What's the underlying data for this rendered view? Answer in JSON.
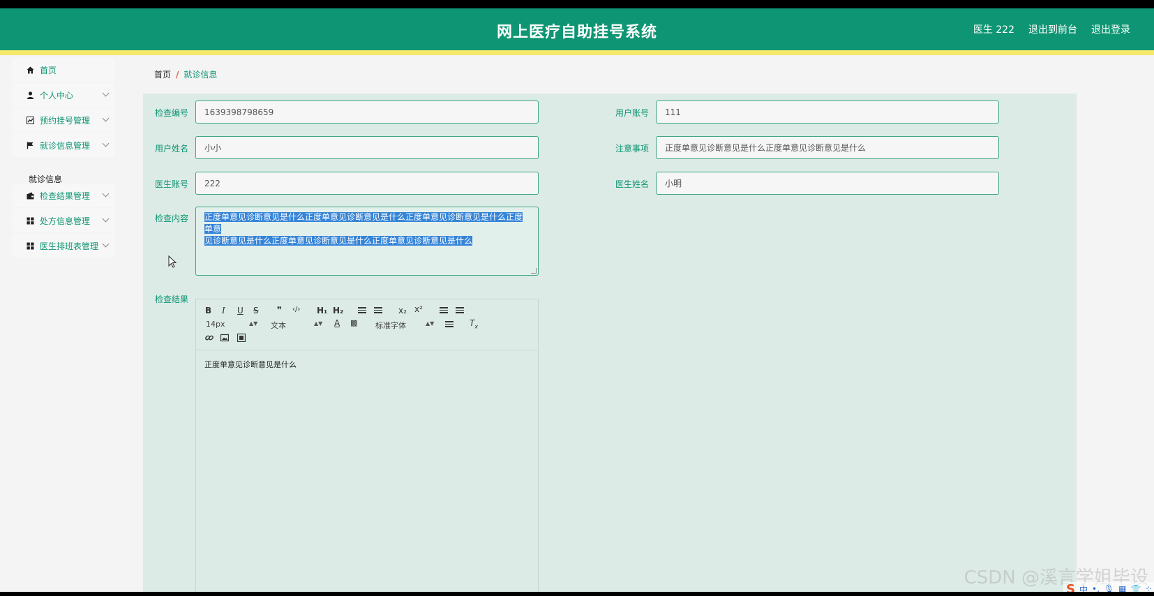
{
  "header": {
    "title": "网上医疗自助挂号系统",
    "user": "医生 222",
    "exit_front": "退出到前台",
    "logout": "退出登录"
  },
  "sidebar": {
    "items": [
      {
        "label": "首页",
        "icon": "home-icon"
      },
      {
        "label": "个人中心",
        "icon": "user-icon"
      },
      {
        "label": "预约挂号管理",
        "icon": "chart-icon"
      },
      {
        "label": "就诊信息管理",
        "icon": "flag-icon"
      },
      {
        "label": "检查结果管理",
        "icon": "wallet-icon"
      },
      {
        "label": "处方信息管理",
        "icon": "grid-icon"
      },
      {
        "label": "医生排班表管理",
        "icon": "grid-icon"
      }
    ],
    "submenu": "就诊信息"
  },
  "breadcrumb": {
    "home": "首页",
    "separator": "/",
    "current": "就诊信息"
  },
  "form": {
    "exam_no": {
      "label": "检查编号",
      "value": "1639398798659"
    },
    "user_account": {
      "label": "用户账号",
      "value": "111"
    },
    "user_name": {
      "label": "用户姓名",
      "value": "小小"
    },
    "notes": {
      "label": "注意事项",
      "value": "正度单意见诊断意见是什么正度单意见诊断意见是什么"
    },
    "doctor_account": {
      "label": "医生账号",
      "value": "222"
    },
    "doctor_name": {
      "label": "医生姓名",
      "value": "小明"
    },
    "exam_content": {
      "label": "检查内容",
      "line1": "正度单意见诊断意见是什么正度单意见诊断意见是什么正度单意见诊断意见是什么正度单意",
      "line2": "见诊断意见是什么正度单意见诊断意见是什么正度单意见诊断意见是什么"
    },
    "exam_result": {
      "label": "检查结果",
      "content": "正度单意见诊断意见是什么",
      "font_size": "14px",
      "text_type": "文本",
      "font_family": "标准字体"
    }
  },
  "toolbar": {
    "bold": "B",
    "italic": "I",
    "underline": "U",
    "strike": "S",
    "quote": "❞",
    "code": "‹/›",
    "h1": "H₁",
    "h2": "H₂",
    "sub": "x₂",
    "sup": "x²"
  },
  "watermark": "CSDN @溪言学姐毕设",
  "ime": {
    "logo": "S",
    "lang": "中"
  }
}
